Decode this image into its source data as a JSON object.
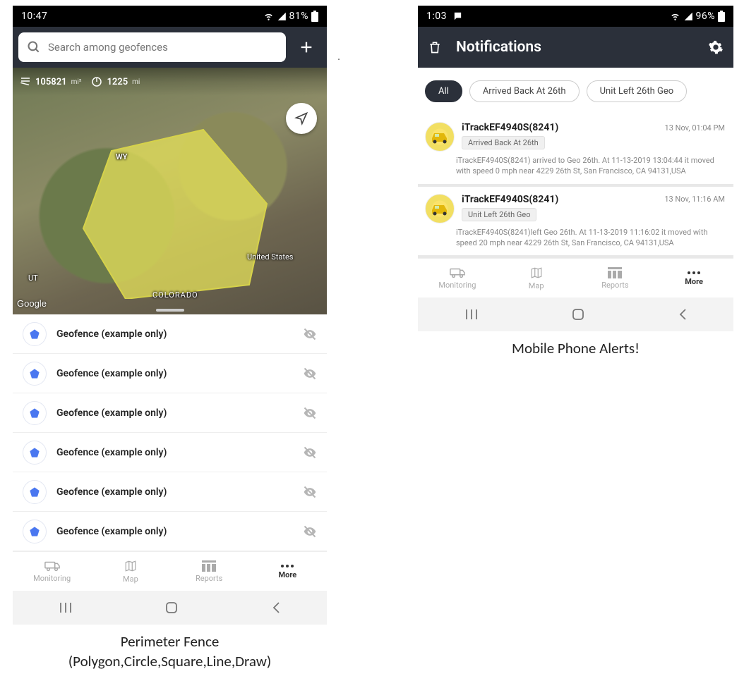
{
  "left": {
    "status": {
      "time": "10:47",
      "battery": "81%"
    },
    "search_placeholder": "Search among geofences",
    "metrics": {
      "area_val": "105821",
      "area_unit": "mi²",
      "dist_val": "1225",
      "dist_unit": "mi"
    },
    "map_labels": {
      "wy": "WY",
      "us": "United States",
      "co": "COLORADO",
      "ut": "UT",
      "google": "Google"
    },
    "geofence_list": [
      {
        "label": "Geofence (example only)"
      },
      {
        "label": "Geofence (example only)"
      },
      {
        "label": "Geofence (example only)"
      },
      {
        "label": "Geofence (example only)"
      },
      {
        "label": "Geofence (example only)"
      },
      {
        "label": "Geofence (example only)"
      }
    ],
    "tabs": {
      "monitoring": "Monitoring",
      "map": "Map",
      "reports": "Reports",
      "more": "More"
    },
    "caption1": "Perimeter Fence",
    "caption2": "(Polygon,Circle,Square,Line,Draw)"
  },
  "right": {
    "status": {
      "time": "1:03",
      "battery": "96%"
    },
    "title": "Notifications",
    "chips": {
      "all": "All",
      "c1": "Arrived Back At 26th",
      "c2": "Unit Left 26th Geo"
    },
    "notifs": [
      {
        "name": "iTrackEF4940S(8241)",
        "time": "13 Nov, 01:04 PM",
        "tag": "Arrived Back At 26th",
        "desc": "iTrackEF4940S(8241) arrived to Geo 26th.    At 11-13-2019 13:04:44 it moved with speed 0 mph near 4229 26th St, San Francisco, CA 94131,USA"
      },
      {
        "name": "iTrackEF4940S(8241)",
        "time": "13 Nov, 11:16 AM",
        "tag": "Unit Left 26th Geo",
        "desc": "iTrackEF4940S(8241)left Geo 26th.    At 11-13-2019 11:16:02 it moved with speed 20 mph near 4229 26th St, San Francisco, CA 94131,USA"
      }
    ],
    "tabs": {
      "monitoring": "Monitoring",
      "map": "Map",
      "reports": "Reports",
      "more": "More"
    },
    "caption": "Mobile Phone Alerts!"
  }
}
